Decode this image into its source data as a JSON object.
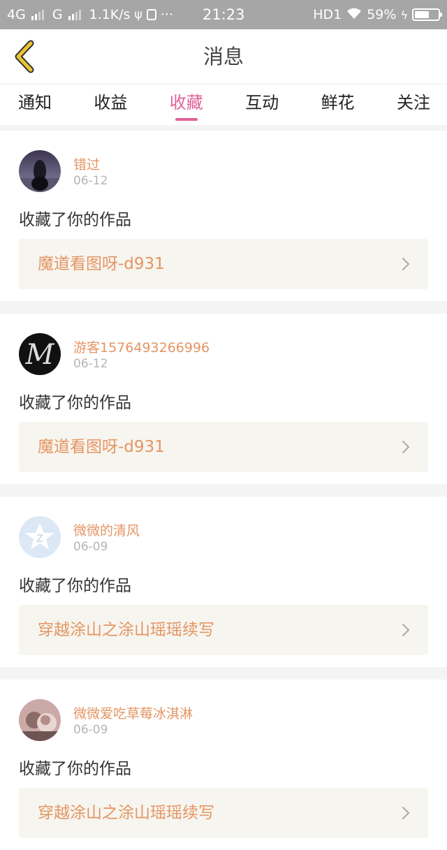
{
  "status_bar": {
    "network1": "4G",
    "network2": "G",
    "speed": "1.1K/s",
    "dots": "···",
    "time": "21:23",
    "hd": "HD1",
    "battery": "59%"
  },
  "header": {
    "title": "消息"
  },
  "tabs": [
    {
      "label": "通知",
      "active": false
    },
    {
      "label": "收益",
      "active": false
    },
    {
      "label": "收藏",
      "active": true
    },
    {
      "label": "互动",
      "active": false
    },
    {
      "label": "鲜花",
      "active": false
    },
    {
      "label": "关注",
      "active": false
    }
  ],
  "messages": [
    {
      "user": "错过",
      "date": "06-12",
      "action": "收藏了你的作品",
      "work": "魔道看图呀-d931"
    },
    {
      "user": "游客1576493266996",
      "date": "06-12",
      "action": "收藏了你的作品",
      "work": "魔道看图呀-d931"
    },
    {
      "user": "微微的清风",
      "date": "06-09",
      "action": "收藏了你的作品",
      "work": "穿越涂山之涂山瑶瑶续写"
    },
    {
      "user": "微微爱吃草莓冰淇淋",
      "date": "06-09",
      "action": "收藏了你的作品",
      "work": "穿越涂山之涂山瑶瑶续写"
    }
  ],
  "colors": {
    "accent": "#e2629a",
    "username": "#e49563",
    "back_icon": "#e8c531"
  }
}
